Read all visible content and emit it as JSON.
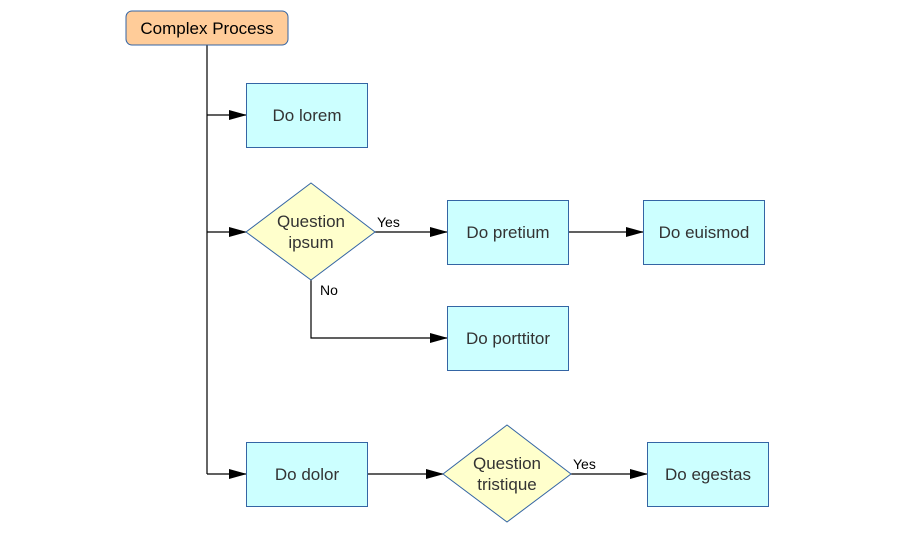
{
  "diagram": {
    "title": "Complex Process",
    "colors": {
      "start_fill": "#FFCC99",
      "start_stroke": "#3465A4",
      "process_fill": "#CCFFFF",
      "process_stroke": "#3465A4",
      "decision_fill": "#FFFFCC",
      "decision_stroke": "#3465A4",
      "edge": "#000000"
    },
    "nodes": [
      {
        "id": "start",
        "type": "terminator",
        "label": "Complex Process"
      },
      {
        "id": "lorem",
        "type": "process",
        "label": "Do lorem"
      },
      {
        "id": "q_ipsum",
        "type": "decision",
        "label_lines": [
          "Question",
          "ipsum"
        ]
      },
      {
        "id": "pretium",
        "type": "process",
        "label": "Do pretium"
      },
      {
        "id": "euismod",
        "type": "process",
        "label": "Do euismod"
      },
      {
        "id": "porttitor",
        "type": "process",
        "label": "Do porttitor"
      },
      {
        "id": "dolor",
        "type": "process",
        "label": "Do dolor"
      },
      {
        "id": "q_tristique",
        "type": "decision",
        "label_lines": [
          "Question",
          "tristique"
        ]
      },
      {
        "id": "egestas",
        "type": "process",
        "label": "Do egestas"
      }
    ],
    "edges": [
      {
        "from": "start",
        "to": "lorem",
        "label": ""
      },
      {
        "from": "start",
        "to": "q_ipsum",
        "label": ""
      },
      {
        "from": "start",
        "to": "dolor",
        "label": ""
      },
      {
        "from": "q_ipsum",
        "to": "pretium",
        "label": "Yes"
      },
      {
        "from": "q_ipsum",
        "to": "porttitor",
        "label": "No"
      },
      {
        "from": "pretium",
        "to": "euismod",
        "label": ""
      },
      {
        "from": "dolor",
        "to": "q_tristique",
        "label": ""
      },
      {
        "from": "q_tristique",
        "to": "egestas",
        "label": "Yes"
      }
    ]
  }
}
